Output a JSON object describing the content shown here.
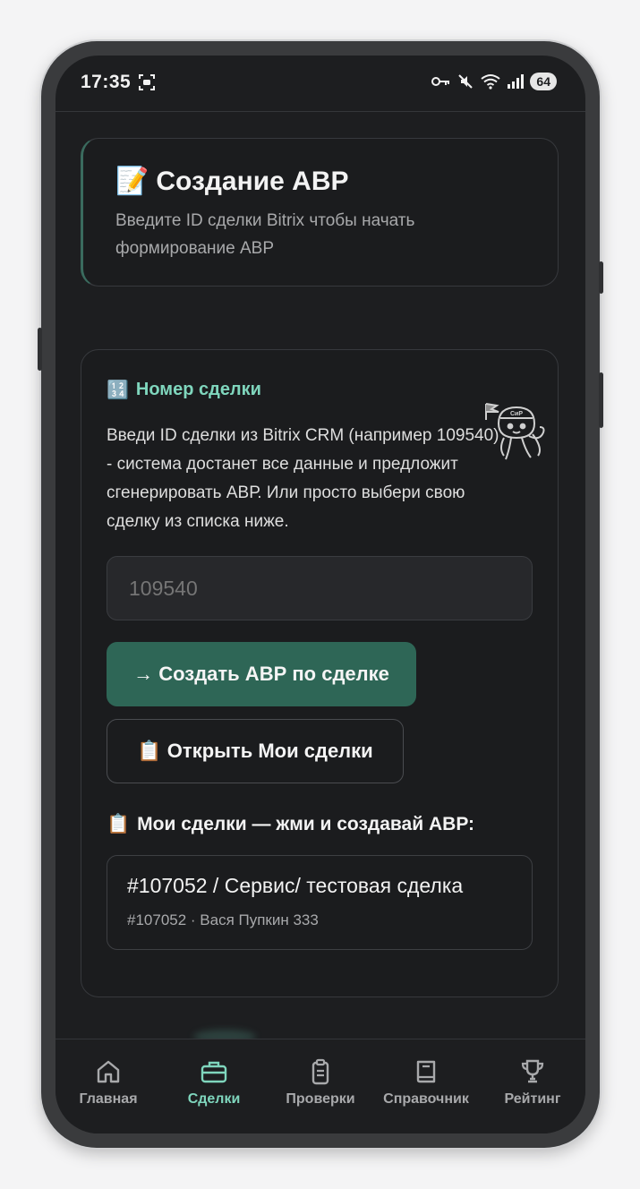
{
  "status": {
    "time": "17:35",
    "battery": "64"
  },
  "header": {
    "emoji": "📝",
    "title": "Создание АВР",
    "subtitle": "Введите ID сделки Bitrix чтобы начать формирование АВР"
  },
  "form": {
    "section_emoji": "🔢",
    "section_label": "Номер сделки",
    "description": "Введи ID сделки из Bitrix CRM (например 109540) - система достанет все данные и предложит сгенерировать АВР. Или просто выбери свою сделку из списка ниже.",
    "input_placeholder": "109540",
    "create_button": "→ Создать АВР по сделке",
    "open_deals_button": "📋 Открыть Мои сделки",
    "mascot_text": "СиР"
  },
  "deals": {
    "label_emoji": "📋",
    "label": "Мои сделки — жми и создавай АВР:",
    "items": [
      {
        "title": "#107052 / Сервис/ тестовая сделка",
        "subtitle": "#107052 · Вася Пупкин 333"
      }
    ]
  },
  "nav": {
    "items": [
      {
        "label": "Главная",
        "icon": "home-icon",
        "active": false
      },
      {
        "label": "Сделки",
        "icon": "briefcase-icon",
        "active": true
      },
      {
        "label": "Проверки",
        "icon": "clipboard-icon",
        "active": false
      },
      {
        "label": "Справочник",
        "icon": "book-icon",
        "active": false
      },
      {
        "label": "Рейтинг",
        "icon": "trophy-icon",
        "active": false
      }
    ]
  },
  "colors": {
    "accent": "#7fd6bd",
    "primary_button": "#2e6656",
    "background": "#1d1e20"
  }
}
